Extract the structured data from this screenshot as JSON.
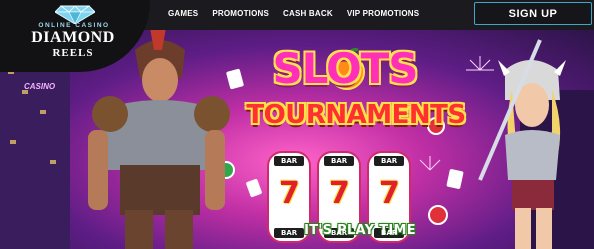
{
  "logo": {
    "small_text": "ONLINE CASINO",
    "main_text": "DIAMOND",
    "sub_text": "REELS"
  },
  "nav": {
    "items": [
      {
        "label": "GAMES"
      },
      {
        "label": "PROMOTIONS"
      },
      {
        "label": "CASH BACK"
      },
      {
        "label": "VIP PROMOTIONS"
      }
    ]
  },
  "header": {
    "signup_label": "SIGN UP"
  },
  "banner": {
    "headline_top": "SLOTS",
    "headline_bottom": "TOURNAMENTS",
    "tagline": "IT'S PLAY TIME",
    "casino_sign": "CASINO",
    "reel_top_label": "BAR",
    "reel_symbol": "7",
    "reel_bottom_label": "BAR"
  },
  "colors": {
    "accent_border": "#3fa7c8",
    "headline_pink": "#ff2fb8",
    "headline_red": "#ff3030",
    "outline_yellow": "#ffe14a",
    "tagline_green": "#2c7a1b"
  },
  "icons": {
    "logo_icon": "diamond-icon"
  }
}
